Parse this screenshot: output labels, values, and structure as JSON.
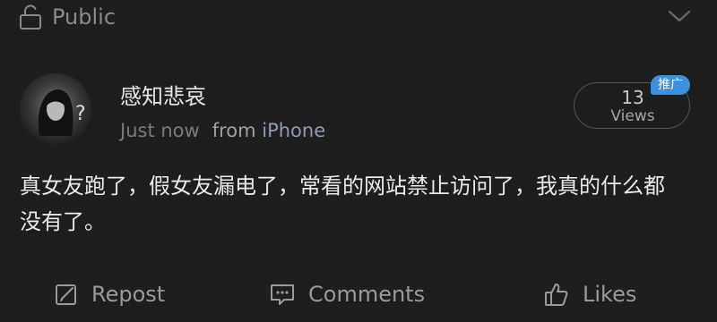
{
  "visibility": {
    "label": "Public",
    "icon": "unlock-icon"
  },
  "header": {
    "expand_icon": "chevron-down-icon"
  },
  "author": {
    "name": "感知悲哀",
    "avatar_icon": "avatar"
  },
  "post": {
    "time": "Just now",
    "source_prefix": "from",
    "source_name": "iPhone",
    "content": "真女友跑了，假女友漏电了，常看的网站禁止访问了，我真的什么都没有了。"
  },
  "views": {
    "count": "13",
    "label": "Views",
    "badge": "推广"
  },
  "actions": {
    "repost": {
      "label": "Repost",
      "icon": "repost-icon"
    },
    "comments": {
      "label": "Comments",
      "icon": "comment-icon"
    },
    "likes": {
      "label": "Likes",
      "icon": "thumbs-up-icon"
    }
  },
  "colors": {
    "background": "#1e1e1e",
    "text_primary": "#eaeaea",
    "text_secondary": "#7b7b7b",
    "accent_badge": "#3d8fe0"
  }
}
